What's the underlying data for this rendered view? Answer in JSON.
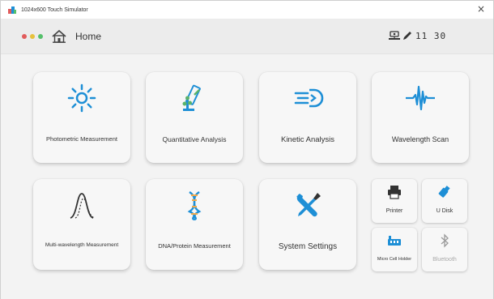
{
  "window": {
    "title": "1024x600 Touch Simulator",
    "close_glyph": "×"
  },
  "appbar": {
    "dots": [
      "#e15c5c",
      "#e6c13c",
      "#55c06b"
    ],
    "home_label": "Home",
    "status_icons": [
      "network-icon",
      "pen-icon"
    ],
    "clock": "11 30"
  },
  "colors": {
    "accent_blue": "#1e8fd6",
    "accent_orange": "#f0a94b",
    "accent_green": "#5bb36b"
  },
  "tiles": [
    {
      "label": "Photometric Measurement",
      "icon": "sun-icon"
    },
    {
      "label": "Quantitative Analysis",
      "icon": "lab-flask-icon"
    },
    {
      "label": "Kinetic Analysis",
      "icon": "kinetic-icon"
    },
    {
      "label": "Wavelength Scan",
      "icon": "waveform-icon"
    },
    {
      "label": "Multi-wavelength Measurement",
      "icon": "peak-curve-icon"
    },
    {
      "label": "DNA/Protein Measurement",
      "icon": "dna-icon"
    },
    {
      "label": "System Settings",
      "icon": "wrench-screwdriver-icon"
    }
  ],
  "mini_tiles": [
    {
      "label": "Printer",
      "icon": "printer-icon",
      "enabled": true
    },
    {
      "label": "U Disk",
      "icon": "usb-icon",
      "enabled": true
    },
    {
      "label": "Micro Cell Holder",
      "icon": "cell-holder-icon",
      "enabled": true
    },
    {
      "label": "Bluetooth",
      "icon": "bluetooth-icon",
      "enabled": false
    }
  ]
}
